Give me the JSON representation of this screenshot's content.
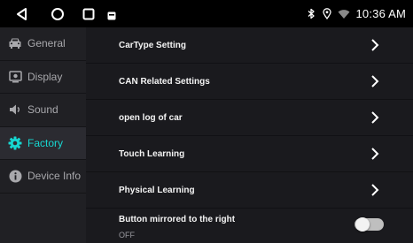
{
  "statusbar": {
    "icons": [
      "back-icon",
      "home-icon",
      "recent-apps-icon",
      "notification-icon",
      "bluetooth-icon",
      "location-icon",
      "wifi-icon"
    ],
    "time": "10:36 AM"
  },
  "sidebar": {
    "items": [
      {
        "label": "General",
        "icon": "car-icon",
        "active": false
      },
      {
        "label": "Display",
        "icon": "display-icon",
        "active": false
      },
      {
        "label": "Sound",
        "icon": "speaker-icon",
        "active": false
      },
      {
        "label": "Factory",
        "icon": "gear-icon",
        "active": true
      },
      {
        "label": "Device Info",
        "icon": "info-icon",
        "active": false
      }
    ]
  },
  "main": {
    "rows": [
      {
        "label": "CarType Setting"
      },
      {
        "label": "CAN Related Settings"
      },
      {
        "label": "open log of car"
      },
      {
        "label": "Touch Learning"
      },
      {
        "label": "Physical Learning"
      }
    ],
    "toggle": {
      "label": "Button mirrored to the right",
      "state": "OFF",
      "on": false
    }
  },
  "colors": {
    "accent": "#17d7d1",
    "sidebar_bg": "#202024",
    "main_bg": "#1a1a1e",
    "statusbar_bg": "#000000"
  }
}
